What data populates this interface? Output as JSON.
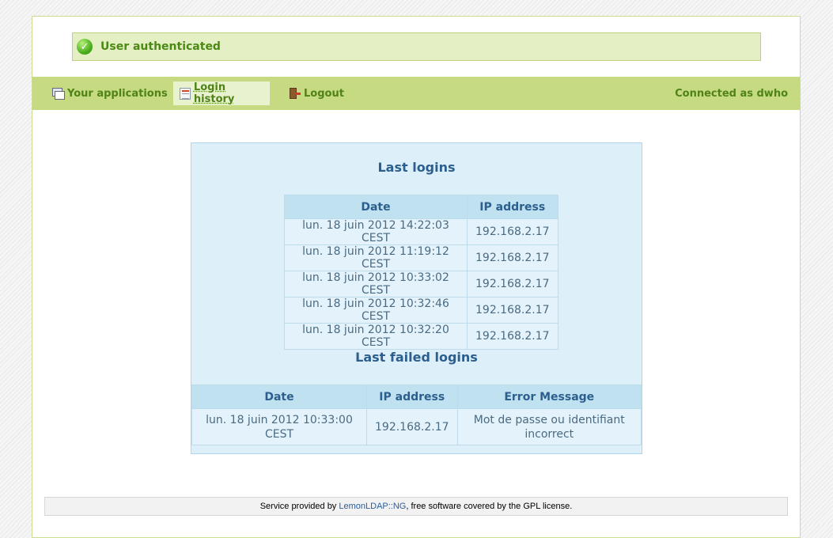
{
  "auth": {
    "message": "User authenticated"
  },
  "menu": {
    "items": [
      {
        "label": "Your applications",
        "icon": "applications-icon"
      },
      {
        "label": "Login history",
        "icon": "history-icon"
      },
      {
        "label": "Logout",
        "icon": "logout-icon"
      }
    ],
    "connected": "Connected as dwho"
  },
  "last_logins": {
    "title": "Last logins",
    "headers": [
      "Date",
      "IP address"
    ],
    "rows": [
      [
        "lun. 18 juin 2012 14:22:03 CEST",
        "192.168.2.17"
      ],
      [
        "lun. 18 juin 2012 11:19:12 CEST",
        "192.168.2.17"
      ],
      [
        "lun. 18 juin 2012 10:33:02 CEST",
        "192.168.2.17"
      ],
      [
        "lun. 18 juin 2012 10:32:46 CEST",
        "192.168.2.17"
      ],
      [
        "lun. 18 juin 2012 10:32:20 CEST",
        "192.168.2.17"
      ]
    ]
  },
  "failed_logins": {
    "title": "Last failed logins",
    "headers": [
      "Date",
      "IP address",
      "Error Message"
    ],
    "rows": [
      [
        "lun. 18 juin 2012 10:33:00 CEST",
        "192.168.2.17",
        "Mot de passe ou identifiant incorrect"
      ]
    ]
  },
  "footer": {
    "prefix": "Service provided by ",
    "link": "LemonLDAP::NG",
    "suffix": ", free software covered by the GPL license."
  },
  "colors": {
    "accent": "#c6da82",
    "success": "#4a8a12",
    "table_header": "#bfe1f0"
  }
}
